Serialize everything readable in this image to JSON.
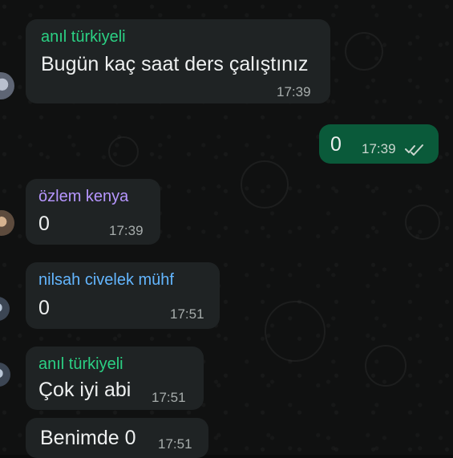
{
  "colors": {
    "background": "#101111",
    "incoming_bubble": "#1f2324",
    "outgoing_bubble": "#0a5a3a",
    "sender_anil": "#2bd184",
    "sender_ozlem": "#b696ff",
    "sender_nilsah": "#63b6ff",
    "time_text": "#a7adac"
  },
  "messages": [
    {
      "sender": "anıl türkiyeli",
      "text": "Bugün kaç saat ders çalıştınız",
      "time": "17:39"
    },
    {
      "text": "0",
      "time": "17:39",
      "status_icon": "double-check-read-icon"
    },
    {
      "sender": "özlem kenya",
      "text": "0",
      "time": "17:39"
    },
    {
      "sender": "nilsah civelek mühf",
      "text": "0",
      "time": "17:51"
    },
    {
      "sender": "anıl türkiyeli",
      "text": "Çok iyi abi",
      "time": "17:51"
    },
    {
      "text": "Benimde 0",
      "time": "17:51"
    }
  ]
}
